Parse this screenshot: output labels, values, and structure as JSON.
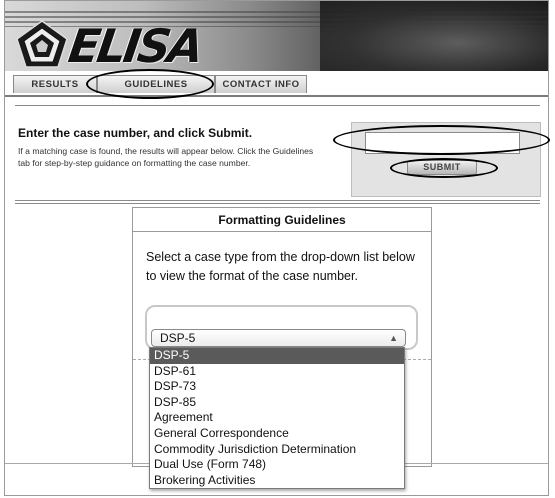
{
  "brand": {
    "logo_text": "ELISA"
  },
  "tabs": [
    {
      "label": "RESULTS"
    },
    {
      "label": "GUIDELINES"
    },
    {
      "label": "CONTACT INFO"
    }
  ],
  "search": {
    "prompt": "Enter the case number, and click Submit.",
    "help": "If a matching case is found, the results will appear below. Click the Guidelines tab for step-by-step guidance on formatting the case number.",
    "input_value": "",
    "submit_label": "SUBMIT"
  },
  "guidelines": {
    "title": "Formatting Guidelines",
    "instructions": "Select a case type from the drop-down list below to view the format of the case number.",
    "select_value": "DSP-5",
    "options": [
      "DSP-5",
      "DSP-61",
      "DSP-73",
      "DSP-85",
      "Agreement",
      "General Correspondence",
      "Commodity Jurisdiction Determination",
      "Dual Use (Form 748)",
      "Brokering Activities"
    ],
    "selected_index": 0
  },
  "colors": {
    "highlight": "#5a5a5a",
    "tab_border": "#8a8a8a",
    "panel_border": "#9a9a9a"
  }
}
